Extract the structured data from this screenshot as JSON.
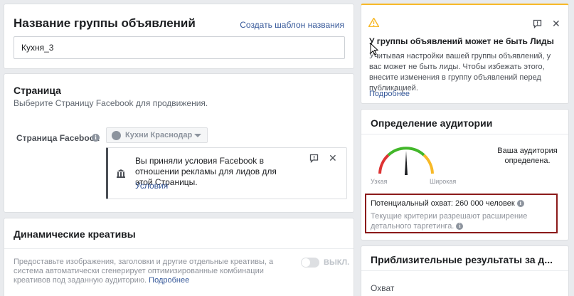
{
  "ad_group_name": {
    "title": "Название группы объявлений",
    "create_template_link": "Создать шаблон названия",
    "input_value": "Кухня_3"
  },
  "page_section": {
    "title": "Страница",
    "subtitle": "Выберите Страницу Facebook для продвижения.",
    "field_label": "Страница Facebook",
    "selected_page": "Кухни Краснодар",
    "notice_text": "Вы приняли условия Facebook в отношении рекламы для лидов для этой Страницы.",
    "notice_link": "Условия"
  },
  "dynamic_creatives": {
    "title": "Динамические креативы",
    "description": "Предоставьте изображения, заголовки и другие отдельные креативы, а система автоматически сгенерирует оптимизированные комбинации креативов под заданную аудиторию.",
    "learn_more": "Подробнее",
    "toggle_label": "ВЫКЛ."
  },
  "warning": {
    "title": "У группы объявлений может не быть Лиды",
    "text": "Учитывая настройки вашей группы объявлений, у вас может не быть лиды. Чтобы избежать этого, внесите изменения в группу объявлений перед публикацией.",
    "learn_more": "Подробнее",
    "accent_color": "#f7b928"
  },
  "audience": {
    "title": "Определение аудитории",
    "gauge_left": "Узкая",
    "gauge_right": "Широкая",
    "status": "Ваша аудитория определена.",
    "potential_reach": "Потенциальный охват: 260 000 человек",
    "criteria_note": "Текущие критерии разрешают расширение детального таргетинга.",
    "gauge_level": 0.5
  },
  "estimates": {
    "title": "Приблизительные результаты за д...",
    "reach_label": "Охват"
  },
  "icons": {
    "warning": "warning-triangle-icon",
    "feedback": "feedback-icon",
    "close": "close-icon",
    "info": "info-icon",
    "bank": "bank-icon"
  }
}
